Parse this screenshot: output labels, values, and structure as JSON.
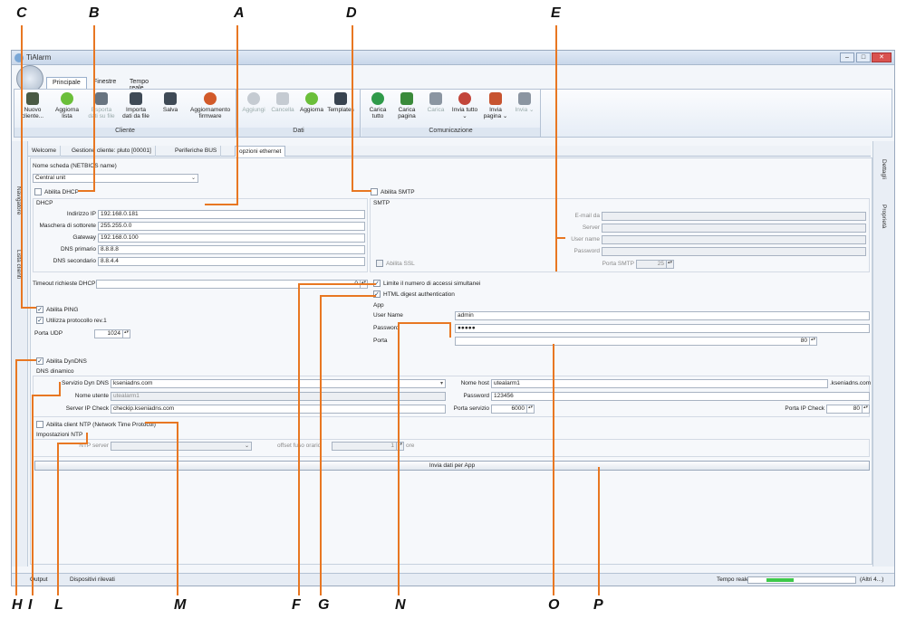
{
  "annotations": {
    "A": "A",
    "B": "B",
    "C": "C",
    "D": "D",
    "E": "E",
    "F": "F",
    "G": "G",
    "H": "H",
    "I": "I",
    "L": "L",
    "M": "M",
    "N": "N",
    "O": "O",
    "P": "P"
  },
  "window": {
    "title": "TiAlarm",
    "min": "–",
    "max": "□",
    "close": "✕"
  },
  "ribbon_tabs": [
    "Principale",
    "Finestre",
    "Tempo reale"
  ],
  "ribbon": {
    "cliente": {
      "label": "Cliente",
      "buttons": [
        "Nuovo cliente...",
        "Aggiorna lista",
        "Esporta dati su file",
        "Importa dati da file",
        "Salva",
        "Aggiornamento firmware"
      ]
    },
    "dati": {
      "label": "Dati",
      "buttons": [
        "Aggiungi",
        "Cancella",
        "Aggiorna",
        "Templates"
      ]
    },
    "comunicazione": {
      "label": "Comunicazione",
      "buttons": [
        "Carica tutto",
        "Carica pagina",
        "Carica",
        "Invia tutto ⌄",
        "Invia pagina ⌄",
        "Invia ⌄"
      ]
    }
  },
  "doc_tabs": [
    "Welcome",
    "Gestione cliente: pluto [00001]",
    "Periferiche BUS",
    "opzioni ethernet"
  ],
  "side": {
    "left": [
      "Navigatore",
      "Lista clienti"
    ],
    "right": [
      "Dettagli",
      "Proprietà"
    ]
  },
  "form": {
    "nome_scheda_label": "Nome scheda (NETBIOS name)",
    "nome_scheda_value": "Central unit",
    "dhcp": {
      "enable_label": "Abilita DHCP",
      "group_label": "DHCP",
      "ip_label": "Indirizzo IP",
      "ip_value": "192.168.0.181",
      "mask_label": "Maschera di sottorete",
      "mask_value": "255.255.0.0",
      "gw_label": "Gateway",
      "gw_value": "192.168.0.100",
      "dns1_label": "DNS primario",
      "dns1_value": "8.8.8.8",
      "dns2_label": "DNS secondario",
      "dns2_value": "8.8.4.4"
    },
    "timeout_label": "Timeout richieste DHCP",
    "timeout_value": "0",
    "smtp": {
      "enable_label": "Abilita SMTP",
      "group_label": "SMTP",
      "email_label": "E-mail da",
      "server_label": "Server",
      "user_label": "User name",
      "password_label": "Password",
      "ssl_label": "Abilita SSL",
      "port_label": "Porta SMTP",
      "port_value": "25"
    },
    "limit_label": "Limite il numero di accessi simultanei",
    "digest_label": "HTML digest authentication",
    "app": {
      "group_label": "App",
      "user_label": "User Name",
      "user_value": "admin",
      "password_label": "Password",
      "password_value": "●●●●●",
      "port_label": "Porta",
      "port_value": "80"
    },
    "ping": {
      "enable_label": "Abilita PING",
      "proto_label": "Utilizza protocollo rev.1",
      "udp_label": "Porta UDP",
      "udp_value": "1024"
    },
    "dyndns": {
      "enable_label": "Abilita DynDNS",
      "group_label": "DNS dinamico",
      "service_label": "Servizio Dyn DNS",
      "service_value": "kseniadns.com",
      "user_label": "Nome utente",
      "user_value": "utealarm1",
      "ipcheck_label": "Server IP Check",
      "ipcheck_value": "checkip.kseniadns.com",
      "host_label": "Nome host",
      "host_value": "utealarm1",
      "host_suffix": ".kseniadns.com",
      "password_label": "Password",
      "password_value": "123456",
      "service_port_label": "Porta servizio",
      "service_port_value": "6000",
      "ipcheck_port_label": "Porta IP Check",
      "ipcheck_port_value": "80"
    },
    "ntp": {
      "enable_label": "Abilita client NTP (Network Time Protocol)",
      "group_label": "Impostazioni NTP",
      "server_label": "NTP server",
      "offset_label": "offset fuso orario",
      "offset_value": "1",
      "offset_unit": "ore"
    },
    "send_button": "Invia dati per App"
  },
  "statusbar": {
    "output": "Output",
    "devices": "Dispositivi rilevati",
    "realtime": "Tempo reale",
    "others": "(Altri 4...)",
    "progress": 0.25
  },
  "colors": {
    "annotation_line": "#e87722",
    "accent": "#3a6ea5"
  }
}
